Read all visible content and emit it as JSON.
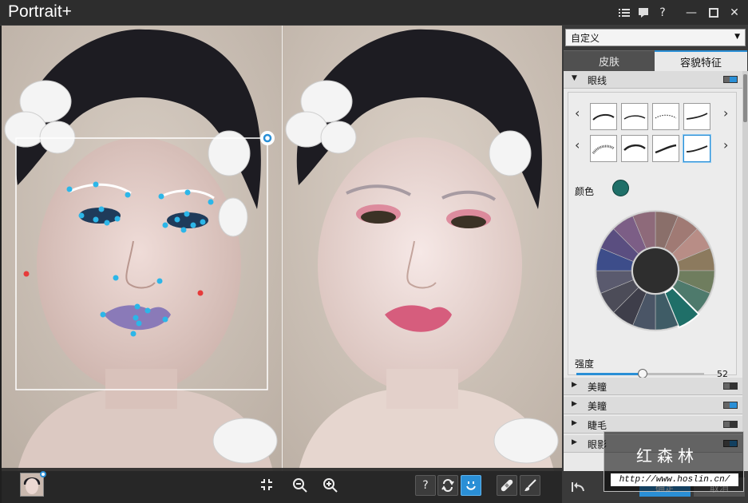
{
  "app": {
    "title": "Portrait+"
  },
  "titlebar": {
    "list_icon": "list-icon",
    "chat_icon": "chat-icon",
    "help_label": "?",
    "minimize_label": "—",
    "maximize_icon": "maximize-icon",
    "close_label": "✕"
  },
  "preset": {
    "value": "自定义"
  },
  "tabs": [
    {
      "label": "皮肤"
    },
    {
      "label": "容貌特征"
    }
  ],
  "sections": {
    "eyeliner": {
      "label": "眼线"
    },
    "color_label": "颜色",
    "intensity_label": "强度",
    "intensity_value": "52",
    "intensity": 52,
    "intensity_max": 100,
    "collapsed": [
      {
        "label": "美瞳"
      },
      {
        "label": "美瞳"
      },
      {
        "label": "睫毛"
      },
      {
        "label": "眼影"
      }
    ]
  },
  "bottom_toolbar": {
    "help_label": "?"
  },
  "footer": {
    "ok_label": "确定",
    "cancel_label": "取消"
  },
  "watermark": {
    "title": "红森林",
    "url": "http://www.hoslin.cn/"
  },
  "colors": {
    "accent": "#2a8fd6",
    "selected_color": "#1f6f68",
    "wheel": [
      "#8a6f6a",
      "#a07a74",
      "#b88d86",
      "#8c7a5e",
      "#6f7d5e",
      "#4e7a6c",
      "#1f6f68",
      "#3f5c66",
      "#4a5566",
      "#3e3e4a",
      "#4c4c58",
      "#5a5a6e",
      "#3d4d8a",
      "#5a4e80",
      "#7c5e86",
      "#8e6a7a"
    ]
  }
}
